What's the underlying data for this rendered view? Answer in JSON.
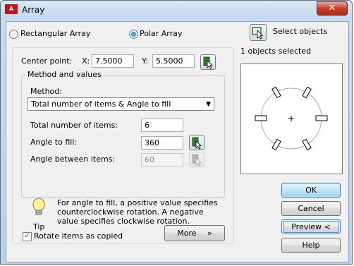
{
  "window": {
    "title": "Array",
    "app_icon_text": "A",
    "close_symbol": "✕"
  },
  "radios": {
    "rectangular": {
      "label": "Rectangular Array",
      "selected": false
    },
    "polar": {
      "label": "Polar Array",
      "selected": true
    }
  },
  "select_objects": {
    "label": "Select objects",
    "count_text": "1 objects selected"
  },
  "center_point": {
    "label": "Center point:",
    "x_label": "X:",
    "x_value": "7.5000",
    "y_label": "Y:",
    "y_value": "5.5000"
  },
  "method_group": {
    "title": "Method and values",
    "method_label": "Method:",
    "method_value": "Total number of items & Angle to fill",
    "total_items_label": "Total number of items:",
    "total_items_value": "6",
    "angle_fill_label": "Angle to fill:",
    "angle_fill_value": "360",
    "angle_between_label": "Angle between items:",
    "angle_between_value": "60"
  },
  "tip": {
    "text": "For angle to fill, a positive value specifies counterclockwise rotation.  A negative value specifies clockwise rotation.",
    "label": "Tip"
  },
  "rotate_items": {
    "label": "Rotate items as copied",
    "checked": true
  },
  "buttons": {
    "more": "More",
    "more_symbol": "»",
    "ok": "OK",
    "cancel": "Cancel",
    "preview": "Preview <",
    "help": "Help"
  },
  "icons": {
    "pick": "pick-point-icon",
    "tip": "lightbulb-icon",
    "select": "select-objects-icon"
  }
}
